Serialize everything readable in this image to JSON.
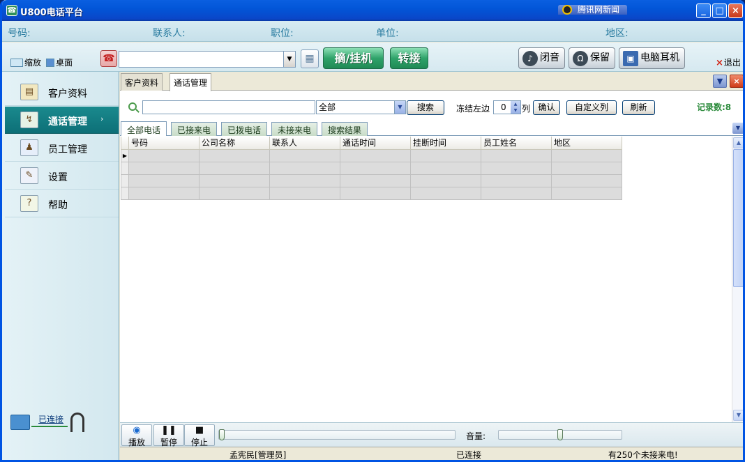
{
  "window": {
    "title": "U800电话平台"
  },
  "info_bar": {
    "phone_label": "号码:",
    "contact_label": "联系人:",
    "position_label": "职位:",
    "company_label": "单位:",
    "region_label": "地区:"
  },
  "toolbar": {
    "shrink_label": "缩放",
    "desktop_label": "桌面",
    "phone_value": "",
    "pickup_hangup_label": "摘/挂机",
    "transfer_label": "转接",
    "mute_label": "闭音",
    "hold_label": "保留",
    "pc_headset_label": "电脑耳机",
    "exit_label": "退出"
  },
  "sidebar": {
    "items": [
      {
        "label": "客户资料",
        "icon": "customer-card-icon"
      },
      {
        "label": "通话管理",
        "icon": "call-management-icon"
      },
      {
        "label": "员工管理",
        "icon": "staff-icon"
      },
      {
        "label": "设置",
        "icon": "settings-icon"
      },
      {
        "label": "帮助",
        "icon": "help-icon"
      }
    ],
    "active_index": 1,
    "connection_status": "已连接"
  },
  "doc_tabs": [
    "客户资料",
    "通话管理"
  ],
  "search": {
    "query": "",
    "scope": "全部",
    "search_button": "搜索",
    "freeze_label": "冻结左边",
    "freeze_value": "0",
    "freeze_unit": "列",
    "confirm_button": "确认",
    "custom_columns_button": "自定义列",
    "refresh_button": "刷新",
    "record_count": "记录数:8"
  },
  "call_tabs": [
    "全部电话",
    "已接来电",
    "已拨电话",
    "未接来电",
    "搜索结果"
  ],
  "grid": {
    "columns": [
      "号码",
      "公司名称",
      "联系人",
      "通话时间",
      "挂断时间",
      "员工姓名",
      "地区"
    ],
    "rows": [
      [
        "",
        "",
        "",
        "",
        "",
        "",
        ""
      ],
      [
        "",
        "",
        "",
        "",
        "",
        "",
        ""
      ],
      [
        "",
        "",
        "",
        "",
        "",
        "",
        ""
      ],
      [
        "",
        "",
        "",
        "",
        "",
        "",
        ""
      ]
    ]
  },
  "player": {
    "play_label": "播放",
    "pause_label": "暂停",
    "stop_label": "停止",
    "volume_label": "音量:",
    "progress": 0.0,
    "volume": 0.5
  },
  "status_bar": {
    "user": "孟宪民[管理员]",
    "connection": "已连接",
    "missed_calls": "有250个未接来电!",
    "qq_news": "腾讯网新闻"
  }
}
